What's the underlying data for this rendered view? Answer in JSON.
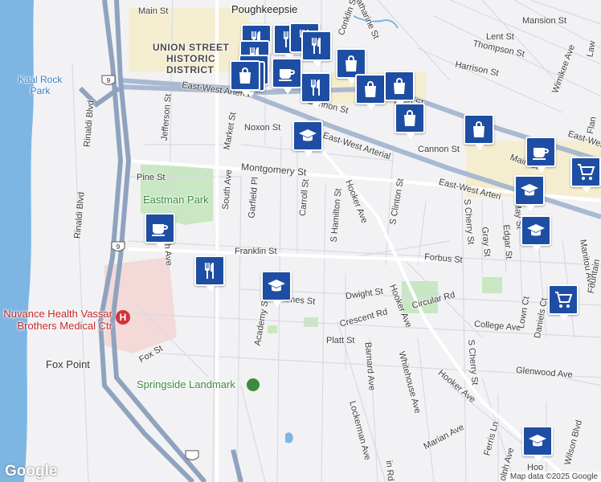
{
  "map": {
    "labels": [
      {
        "name": "label-poughkeepsie",
        "text": "Poughkeepsie"
      },
      {
        "name": "label-union-street",
        "text": "UNION STREET"
      },
      {
        "name": "label-historic",
        "text": "HISTORIC"
      },
      {
        "name": "label-district",
        "text": "DISTRICT"
      },
      {
        "name": "label-kaal-rock-park",
        "text": "Kaal Rock Park"
      },
      {
        "name": "label-eastman-park",
        "text": "Eastman Park"
      },
      {
        "name": "label-springside-landmark",
        "text": "Springside Landmark"
      },
      {
        "name": "label-hospital",
        "text": "Nuvance Health Vassar Brothers Medical Ctr"
      },
      {
        "name": "label-fox-point",
        "text": "Fox Point"
      },
      {
        "name": "label-main-st-1",
        "text": "Main St"
      },
      {
        "name": "label-main-st-2",
        "text": "Main St"
      },
      {
        "name": "label-main-st-3",
        "text": "Main St"
      },
      {
        "name": "label-mansion-st",
        "text": "Mansion St"
      },
      {
        "name": "label-lent-st",
        "text": "Lent St"
      },
      {
        "name": "label-thompson-st",
        "text": "Thompson St"
      },
      {
        "name": "label-harrison-st",
        "text": "Harrison St"
      },
      {
        "name": "label-wimikee-ave",
        "text": "Wimikee Ave"
      },
      {
        "name": "label-conklin-st",
        "text": "Conklin St"
      },
      {
        "name": "label-catharine-st",
        "text": "Catharine St"
      },
      {
        "name": "label-cannon-st-1",
        "text": "Cannon St"
      },
      {
        "name": "label-cannon-st-2",
        "text": "Cannon St"
      },
      {
        "name": "label-noxon-st",
        "text": "Noxon St"
      },
      {
        "name": "label-east-west-arterial-1",
        "text": "East-West Arterial"
      },
      {
        "name": "label-east-west-arterial-2",
        "text": "East-West Arterial"
      },
      {
        "name": "label-east-west-arterial-3",
        "text": "East-West Arterial"
      },
      {
        "name": "label-east-west-arteri",
        "text": "East-West Arteri"
      },
      {
        "name": "label-montgomery-st",
        "text": "Montgomery St"
      },
      {
        "name": "label-pine-st",
        "text": "Pine St"
      },
      {
        "name": "label-market-st",
        "text": "Market St"
      },
      {
        "name": "label-south-ave",
        "text": "South Ave"
      },
      {
        "name": "label-garfield-pl",
        "text": "Garfield Pl"
      },
      {
        "name": "label-carroll-st",
        "text": "Carroll St"
      },
      {
        "name": "label-s-hamilton-st",
        "text": "S Hamilton St"
      },
      {
        "name": "label-hooker-ave-1",
        "text": "Hooker Ave"
      },
      {
        "name": "label-hooker-ave-2",
        "text": "Hooker Ave"
      },
      {
        "name": "label-hooker-ave-3",
        "text": "Hooker Ave"
      },
      {
        "name": "label-s-clinton-st",
        "text": "S Clinton St"
      },
      {
        "name": "label-s-cherry-st-1",
        "text": "S Cherry St"
      },
      {
        "name": "label-s-cherry-st-2",
        "text": "S Cherry St"
      },
      {
        "name": "label-gray-st",
        "text": "Gray St"
      },
      {
        "name": "label-edgar-st",
        "text": "Edgar St"
      },
      {
        "name": "label-may-st",
        "text": "May St"
      },
      {
        "name": "label-manitou-ave",
        "text": "Manitou Ave"
      },
      {
        "name": "label-franklin-st",
        "text": "Franklin St"
      },
      {
        "name": "label-forbus-st",
        "text": "Forbus St"
      },
      {
        "name": "label-dwight-st",
        "text": "Dwight St"
      },
      {
        "name": "label-james-st",
        "text": "ames St"
      },
      {
        "name": "label-circular-rd",
        "text": "Circular Rd"
      },
      {
        "name": "label-crescent-rd",
        "text": "Crescent Rd"
      },
      {
        "name": "label-college-ave",
        "text": "College Ave"
      },
      {
        "name": "label-lown-ct",
        "text": "Lown Ct"
      },
      {
        "name": "label-daniels-ct",
        "text": "Daniels Ct"
      },
      {
        "name": "label-platt-st",
        "text": "Platt St"
      },
      {
        "name": "label-barnard-ave",
        "text": "Barnard Ave"
      },
      {
        "name": "label-whitehouse-ave",
        "text": "Whitehouse Ave"
      },
      {
        "name": "label-glenwood-ave",
        "text": "Glenwood Ave"
      },
      {
        "name": "label-academy-st",
        "text": "Academy St"
      },
      {
        "name": "label-fox-st",
        "text": "Fox St"
      },
      {
        "name": "label-lockerman-ave",
        "text": "Lockerman Ave"
      },
      {
        "name": "label-marian-ave",
        "text": "Marian Ave"
      },
      {
        "name": "label-ferris-ln",
        "text": "Ferris Ln"
      },
      {
        "name": "label-wilson-blvd",
        "text": "Wilson Blvd"
      },
      {
        "name": "label-jefferson-st",
        "text": "Jefferson St"
      },
      {
        "name": "label-rinaldi-blvd-1",
        "text": "Rinaldi Blvd"
      },
      {
        "name": "label-rinaldi-blvd-2",
        "text": "Rinaldi Blvd"
      },
      {
        "name": "label-edge-ave",
        "text": "ih Ave"
      },
      {
        "name": "label-rd-bottom",
        "text": "in Rd"
      },
      {
        "name": "label-olph-ave",
        "text": "olph Ave"
      },
      {
        "name": "label-hooker-ave-cut",
        "text": "Hoo"
      },
      {
        "name": "label-fountain",
        "text": "Fountain"
      },
      {
        "name": "label-flan",
        "text": "Flan"
      },
      {
        "name": "label-lafa",
        "text": "Law"
      },
      {
        "name": "label-route-9-1",
        "text": "9"
      },
      {
        "name": "label-route-9-2",
        "text": "9"
      },
      {
        "name": "label-route-9-3",
        "text": "9"
      }
    ],
    "pois": [
      {
        "type": "restaurant",
        "icon": "fork-knife-icon"
      },
      {
        "type": "restaurant",
        "icon": "fork-knife-icon"
      },
      {
        "type": "restaurant",
        "icon": "fork-knife-icon"
      },
      {
        "type": "restaurant",
        "icon": "fork-knife-icon"
      },
      {
        "type": "restaurant",
        "icon": "fork-knife-icon"
      },
      {
        "type": "restaurant",
        "icon": "fork-knife-icon"
      },
      {
        "type": "restaurant",
        "icon": "fork-knife-icon"
      },
      {
        "type": "shopping",
        "icon": "shopping-bag-icon"
      },
      {
        "type": "shopping",
        "icon": "shopping-bag-icon"
      },
      {
        "type": "shopping",
        "icon": "shopping-bag-icon"
      },
      {
        "type": "shopping",
        "icon": "shopping-bag-icon"
      },
      {
        "type": "shopping",
        "icon": "shopping-bag-icon"
      },
      {
        "type": "shopping",
        "icon": "shopping-bag-icon"
      },
      {
        "type": "shopping",
        "icon": "shopping-bag-icon"
      },
      {
        "type": "shopping",
        "icon": "shopping-bag-icon"
      },
      {
        "type": "cafe",
        "icon": "coffee-cup-icon"
      },
      {
        "type": "cafe",
        "icon": "coffee-cup-icon"
      },
      {
        "type": "cafe",
        "icon": "coffee-cup-icon"
      },
      {
        "type": "school",
        "icon": "graduation-cap-icon"
      },
      {
        "type": "school",
        "icon": "graduation-cap-icon"
      },
      {
        "type": "school",
        "icon": "graduation-cap-icon"
      },
      {
        "type": "school",
        "icon": "graduation-cap-icon"
      },
      {
        "type": "school",
        "icon": "graduation-cap-icon"
      },
      {
        "type": "grocery",
        "icon": "shopping-cart-icon"
      },
      {
        "type": "grocery",
        "icon": "shopping-cart-icon"
      }
    ],
    "colors": {
      "water": "#7fb8e4",
      "land": "#f2f2f4",
      "park": "#c7e8c0",
      "hospital": "#f6dcdc",
      "highway": "#8fa3bf",
      "downtown": "#f7efd0",
      "poi": "#1e4ea3"
    }
  },
  "branding": {
    "logo": "Google"
  },
  "attribution": {
    "text": "Map data ©2025 Google"
  }
}
